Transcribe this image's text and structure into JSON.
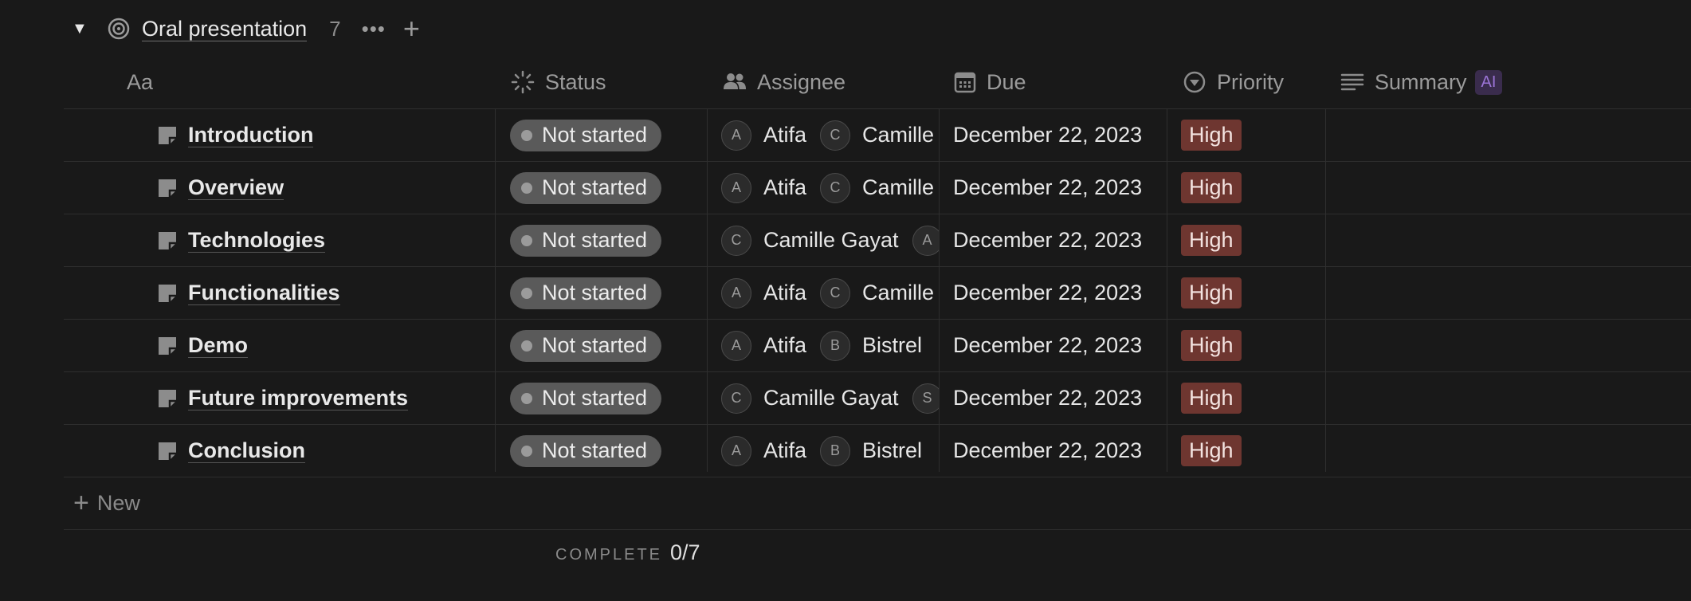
{
  "group": {
    "title": "Oral presentation",
    "count": "7",
    "toggle_icon": "triangle-down-icon",
    "icon": "target-icon",
    "more_label": "•••",
    "add_label": "+"
  },
  "columns": {
    "name": "Aa",
    "status": "Status",
    "assignee": "Assignee",
    "due": "Due",
    "priority": "Priority",
    "summary": "Summary",
    "summary_badge": "AI"
  },
  "rows": [
    {
      "name": "Introduction",
      "status": "Not started",
      "assignees": [
        {
          "initial": "A",
          "name": "Atifa"
        },
        {
          "initial": "C",
          "name": "Camille"
        }
      ],
      "due": "December 22, 2023",
      "priority": "High"
    },
    {
      "name": "Overview",
      "status": "Not started",
      "assignees": [
        {
          "initial": "A",
          "name": "Atifa"
        },
        {
          "initial": "C",
          "name": "Camille"
        }
      ],
      "due": "December 22, 2023",
      "priority": "High"
    },
    {
      "name": "Technologies",
      "status": "Not started",
      "assignees": [
        {
          "initial": "C",
          "name": "Camille Gayat"
        },
        {
          "initial": "A",
          "name": ""
        }
      ],
      "due": "December 22, 2023",
      "priority": "High"
    },
    {
      "name": "Functionalities",
      "status": "Not started",
      "assignees": [
        {
          "initial": "A",
          "name": "Atifa"
        },
        {
          "initial": "C",
          "name": "Camille"
        }
      ],
      "due": "December 22, 2023",
      "priority": "High"
    },
    {
      "name": "Demo",
      "status": "Not started",
      "assignees": [
        {
          "initial": "A",
          "name": "Atifa"
        },
        {
          "initial": "B",
          "name": "Bistrel"
        }
      ],
      "due": "December 22, 2023",
      "priority": "High"
    },
    {
      "name": "Future improvements",
      "status": "Not started",
      "assignees": [
        {
          "initial": "C",
          "name": "Camille Gayat"
        },
        {
          "initial": "S",
          "name": ""
        }
      ],
      "due": "December 22, 2023",
      "priority": "High"
    },
    {
      "name": "Conclusion",
      "status": "Not started",
      "assignees": [
        {
          "initial": "A",
          "name": "Atifa"
        },
        {
          "initial": "B",
          "name": "Bistrel"
        }
      ],
      "due": "December 22, 2023",
      "priority": "High"
    }
  ],
  "new_row": {
    "label": "New"
  },
  "footer": {
    "complete_label": "COMPLETE",
    "complete_value": "0/7"
  },
  "colors": {
    "background": "#191919",
    "status_pill": "#5a5a5a",
    "priority_high": "#6e3630",
    "ai_badge": "#3a2c4d"
  }
}
